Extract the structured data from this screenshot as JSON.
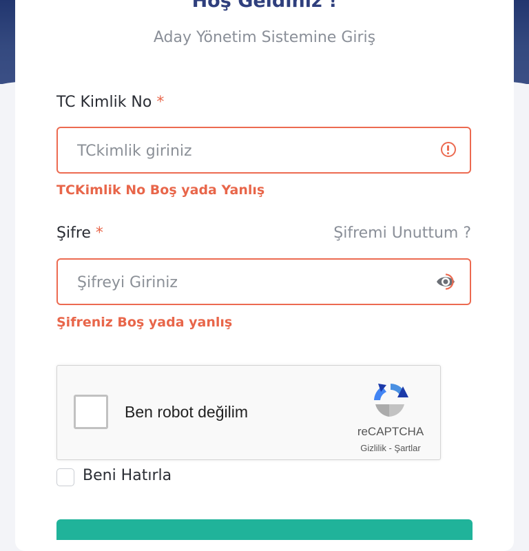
{
  "header": {
    "title": "Hoş Geldiniz !",
    "subtitle": "Aday Yönetim Sistemine Giriş"
  },
  "form": {
    "tc": {
      "label": "TC Kimlik No",
      "required_mark": "*",
      "placeholder": "TCkimlik giriniz",
      "value": "",
      "error": "TCKimlik No Boş yada Yanlış"
    },
    "password": {
      "label": "Şifre",
      "required_mark": "*",
      "placeholder": "Şifreyi Giriniz",
      "value": "",
      "error": "Şifreniz Boş yada yanlış",
      "forgot_link": "Şifremi Unuttum ?"
    },
    "captcha": {
      "label": "Ben robot değilim",
      "brand": "reCAPTCHA",
      "privacy": "Gizlilik",
      "separator": " - ",
      "terms": "Şartlar",
      "checked": false
    },
    "remember": {
      "label": "Beni Hatırla",
      "checked": false
    }
  },
  "colors": {
    "primary": "#2f3f7d",
    "error": "#ec6a50",
    "submit": "#20b39a"
  },
  "icons": {
    "tc_field": "error-circle-icon",
    "password_field": "eye-icon"
  }
}
